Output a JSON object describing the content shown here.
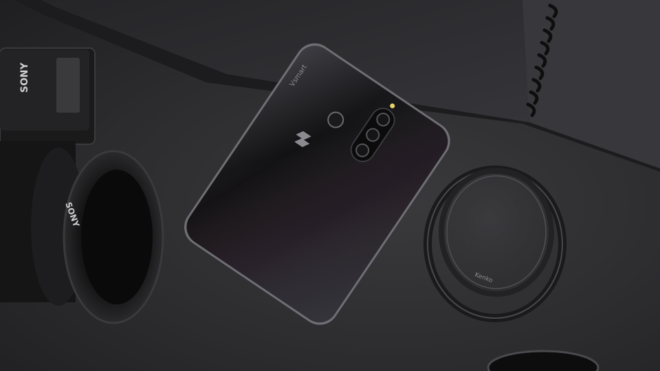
{
  "scene": {
    "description_words": [],
    "labels": {
      "battery_brand": "SONY",
      "lens_brand": "SONY",
      "phone_brand": "Vsmart",
      "filter_brand": "Kenko"
    },
    "colors": {
      "surface": "#2c2c2f",
      "notebook": "#2e2e31",
      "phone_body": "#141416",
      "phone_edge": "#7a7a80",
      "lens_body": "#121213",
      "filter_ring": "#3b3b3e"
    },
    "icons": {
      "phone_logo": "vsmart-logo-icon",
      "fingerprint": "fingerprint-sensor-icon",
      "camera": "triple-camera-icon"
    }
  }
}
